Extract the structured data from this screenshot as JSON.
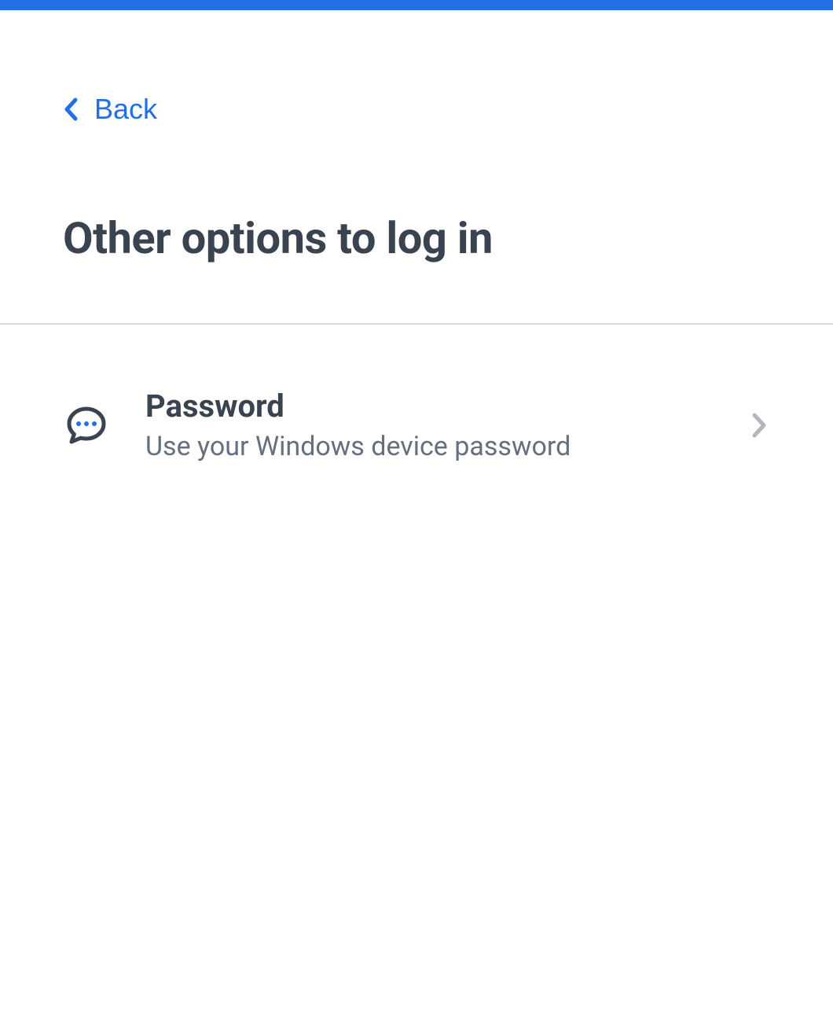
{
  "header": {
    "back_label": "Back",
    "title": "Other options to log in"
  },
  "options": [
    {
      "title": "Password",
      "description": "Use your Windows device password"
    }
  ]
}
